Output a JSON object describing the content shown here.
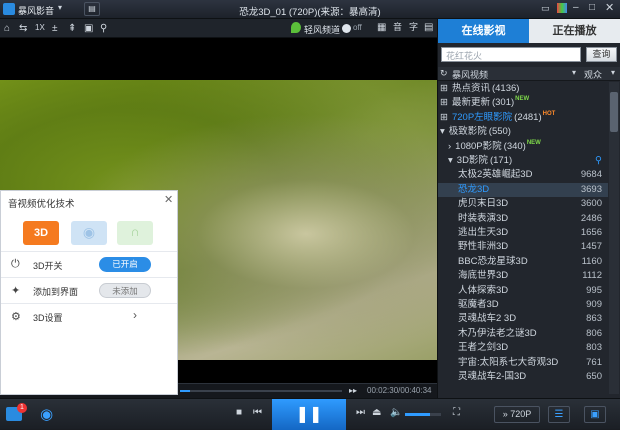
{
  "app": {
    "brand": "暴风影音",
    "title": "恐龙3D_01 (720P)(来源：暴高清)"
  },
  "toolbar": {
    "left_icons": [
      "screenshot-icon",
      "repeat-icon",
      "speed-1x-icon",
      "ratio-icon",
      "pin-icon",
      "location-icon"
    ],
    "light_channel": "轻风频道",
    "light_toggle": "off",
    "right_icons": [
      "picture-icon",
      "audio-icon",
      "subtitle-icon"
    ]
  },
  "sidebar": {
    "tabs": [
      "在线影视",
      "正在播放"
    ],
    "search": {
      "placeholder": "花红花火",
      "button": "查询"
    },
    "header": {
      "source": "暴风视频",
      "view_mode": "观众"
    },
    "categories": [
      {
        "label": "热点资讯",
        "count": "(4136)",
        "badge": ""
      },
      {
        "label": "最新更新",
        "count": "(301)",
        "badge": "NEW"
      },
      {
        "label": "720P左眼影院",
        "count": "(2481)",
        "badge": "HOT"
      },
      {
        "label": "极致影院",
        "count": "(550)",
        "badge": ""
      },
      {
        "label": "1080P影院",
        "count": "(340)",
        "badge": "NEW"
      },
      {
        "label": "3D影院",
        "count": "(171)",
        "badge": ""
      }
    ],
    "items": [
      {
        "label": "太极2英雄崛起3D",
        "count": "9684"
      },
      {
        "label": "恐龙3D",
        "count": "3693"
      },
      {
        "label": "虎贝末日3D",
        "count": "3600"
      },
      {
        "label": "时装表演3D",
        "count": "2486"
      },
      {
        "label": "逃出生天3D",
        "count": "1656"
      },
      {
        "label": "野性非洲3D",
        "count": "1457"
      },
      {
        "label": "BBC恐龙星球3D",
        "count": "1160"
      },
      {
        "label": "海底世界3D",
        "count": "1112"
      },
      {
        "label": "人体探索3D",
        "count": "995"
      },
      {
        "label": "驱魔者3D",
        "count": "909"
      },
      {
        "label": "灵魂战车2 3D",
        "count": "863"
      },
      {
        "label": "木乃伊法老之谜3D",
        "count": "806"
      },
      {
        "label": "王者之剑3D",
        "count": "803"
      },
      {
        "label": "宇宙:太阳系七大奇观3D",
        "count": "761"
      },
      {
        "label": "灵魂战车2-国3D",
        "count": "650"
      }
    ]
  },
  "popup": {
    "title": "音视频优化技术",
    "tabs": [
      "3D",
      "eye-icon",
      "headphone-icon"
    ],
    "rows": [
      {
        "label": "3D开关",
        "state": "已开启"
      },
      {
        "label": "添加到界面",
        "state": "未添加"
      },
      {
        "label": "3D设置",
        "state": ""
      }
    ]
  },
  "player": {
    "time": "00:02:30/00:40:34",
    "progress": 0.06,
    "volume": 0.7,
    "quality": "720P",
    "notify_count": "1"
  },
  "colors": {
    "accent": "#1e7fd6",
    "selected_text": "#2f9bff",
    "pill_on": "#2b8de6",
    "dark_panel": "#22262d",
    "orange": "#f57a1f"
  }
}
